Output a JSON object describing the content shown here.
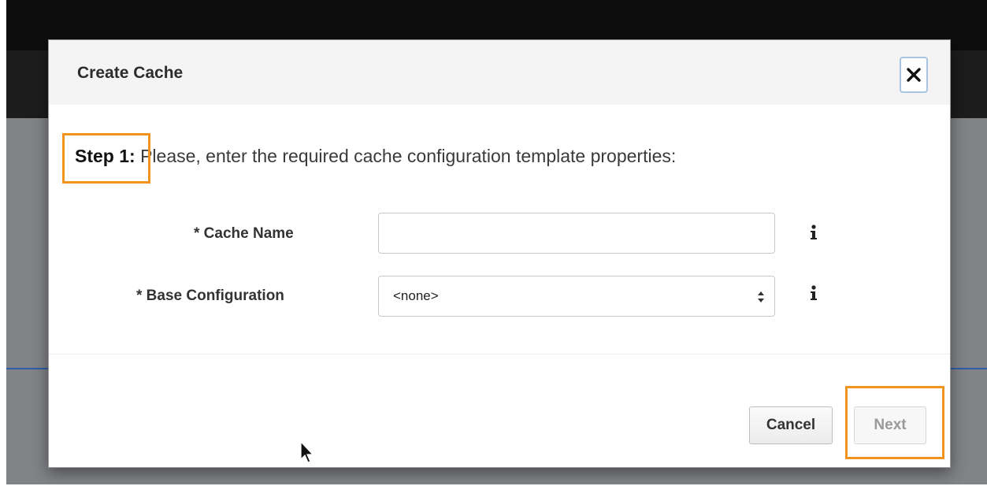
{
  "modal": {
    "title": "Create Cache",
    "close_icon": "close-icon"
  },
  "step": {
    "label": "Step 1:",
    "text": " Please, enter the required cache configuration template properties:"
  },
  "form": {
    "cache_name": {
      "label": "* Cache Name",
      "value": "",
      "placeholder": "",
      "info_icon": "info-icon"
    },
    "base_configuration": {
      "label": "* Base Configuration",
      "selected": "<none>",
      "info_icon": "info-icon"
    }
  },
  "buttons": {
    "cancel_label": "Cancel",
    "next_label": "Next"
  },
  "colors": {
    "highlight": "#f0941d",
    "close_border": "#a9c4e0",
    "backdrop_dark": "#0d0d0d",
    "backdrop_gray": "#818387"
  }
}
